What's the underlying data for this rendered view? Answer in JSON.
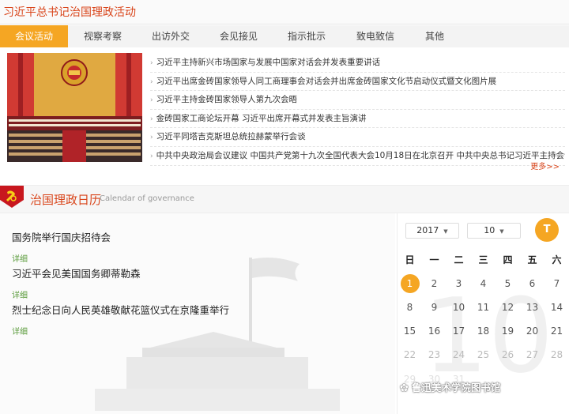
{
  "header": {
    "title": "习近平总书记治国理政活动"
  },
  "tabs": [
    {
      "label": "会议活动",
      "active": true
    },
    {
      "label": "视察考察",
      "active": false
    },
    {
      "label": "出访外交",
      "active": false
    },
    {
      "label": "会见接见",
      "active": false
    },
    {
      "label": "指示批示",
      "active": false
    },
    {
      "label": "致电致信",
      "active": false
    },
    {
      "label": "其他",
      "active": false
    }
  ],
  "news": [
    "习近平主持新兴市场国家与发展中国家对话会并发表重要讲话",
    "习近平出席金砖国家领导人同工商理事会对话会并出席金砖国家文化节启动仪式暨文化图片展",
    "习近平主持金砖国家领导人第九次会晤",
    "金砖国家工商论坛开幕 习近平出席开幕式并发表主旨演讲",
    "习近平同塔吉克斯坦总统拉赫蒙举行会谈",
    "中共中央政治局会议建议 中国共产党第十九次全国代表大会10月18日在北京召开 中共中央总书记习近平主持会议"
  ],
  "more_link": "更多>>",
  "governance": {
    "title_cn": "治国理政日历",
    "title_en": "Calendar of governance",
    "items": [
      {
        "title": "国务院举行国庆招待会",
        "detail": "详细"
      },
      {
        "title": "习近平会见美国国务卿蒂勒森",
        "detail": "详细"
      },
      {
        "title": "烈士纪念日向人民英雄敬献花篮仪式在京隆重举行",
        "detail": "详细"
      }
    ]
  },
  "calendar": {
    "year": "2017",
    "month": "10",
    "today_label": "T",
    "weekdays": [
      "日",
      "一",
      "二",
      "三",
      "四",
      "五",
      "六"
    ],
    "days": [
      "1",
      "2",
      "3",
      "4",
      "5",
      "6",
      "7",
      "8",
      "9",
      "10",
      "11",
      "12",
      "13",
      "14",
      "15",
      "16",
      "17",
      "18",
      "19",
      "20",
      "21",
      "22",
      "23",
      "24",
      "25",
      "26",
      "27",
      "28",
      "29",
      "30",
      "31"
    ],
    "selected_day": "1",
    "watermark_number": "10"
  },
  "wechat": {
    "label": "鲁迅美术学院图书馆"
  },
  "colors": {
    "accent": "#f5a623",
    "brand_red": "#d9461c",
    "detail_green": "#5a9b3b"
  }
}
